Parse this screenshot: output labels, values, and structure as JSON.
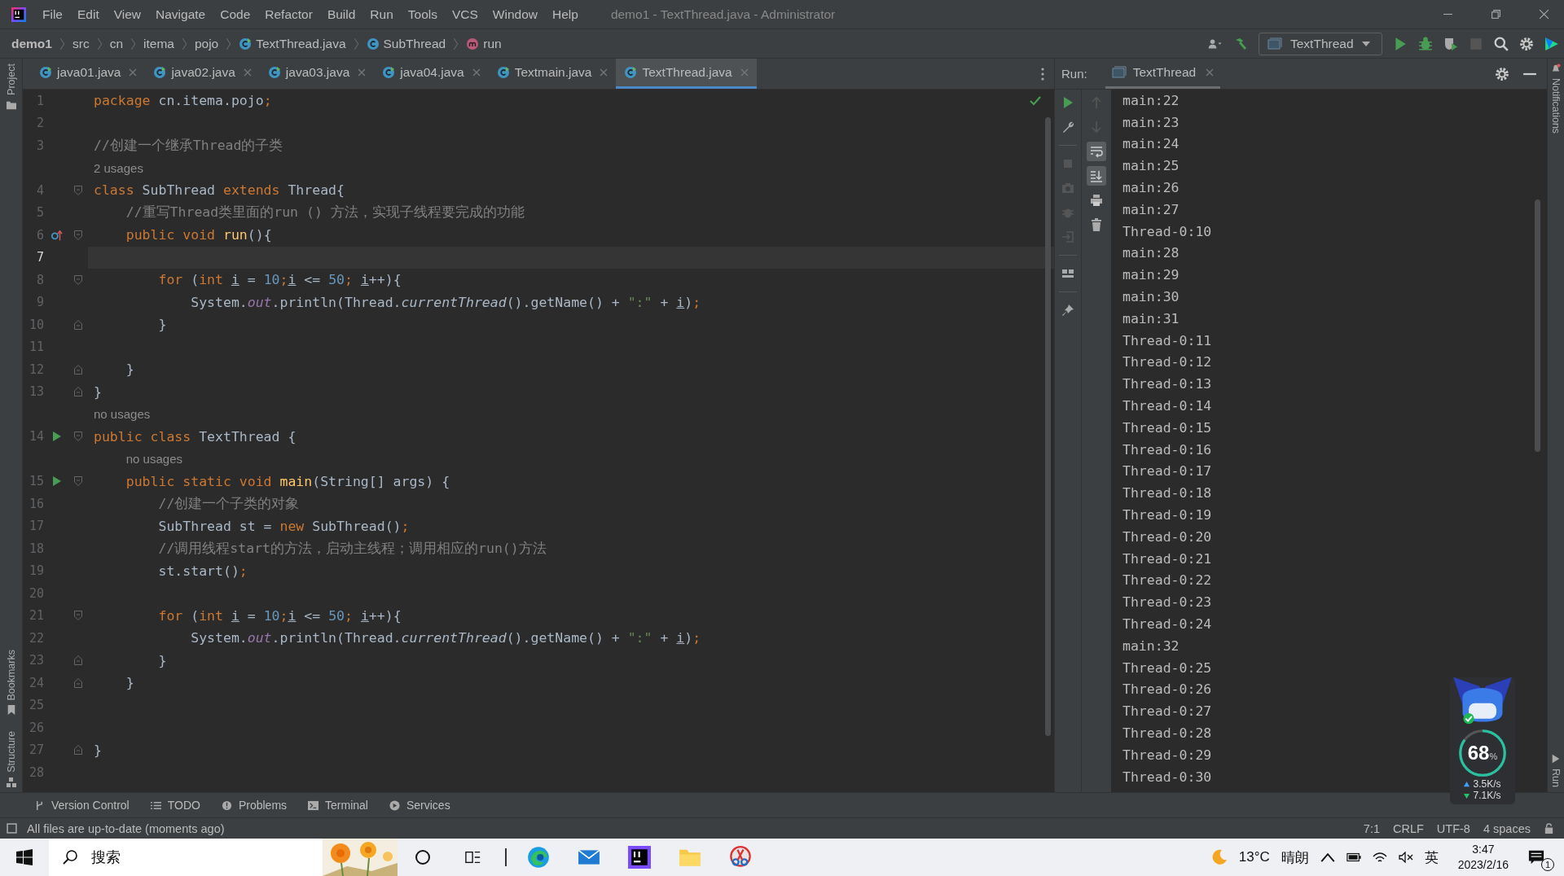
{
  "window": {
    "title": "demo1 - TextThread.java - Administrator"
  },
  "menu": [
    "File",
    "Edit",
    "View",
    "Navigate",
    "Code",
    "Refactor",
    "Build",
    "Run",
    "Tools",
    "VCS",
    "Window",
    "Help"
  ],
  "breadcrumbs": [
    {
      "label": "demo1",
      "kind": "project"
    },
    {
      "label": "src",
      "kind": "folder"
    },
    {
      "label": "cn",
      "kind": "folder"
    },
    {
      "label": "itema",
      "kind": "folder"
    },
    {
      "label": "pojo",
      "kind": "folder"
    },
    {
      "label": "TextThread.java",
      "kind": "file"
    },
    {
      "label": "SubThread",
      "kind": "class"
    },
    {
      "label": "run",
      "kind": "method"
    }
  ],
  "run_config": "TextThread",
  "side_tabs_left_top": [
    "Project"
  ],
  "side_tabs_left_bottom": [
    "Bookmarks",
    "Structure"
  ],
  "side_tabs_right_top": [
    "Notifications"
  ],
  "side_tabs_right_bottom": [
    "Run"
  ],
  "editor_tabs": [
    {
      "label": "java01.java",
      "selected": false
    },
    {
      "label": "java02.java",
      "selected": false
    },
    {
      "label": "java03.java",
      "selected": false
    },
    {
      "label": "java04.java",
      "selected": false
    },
    {
      "label": "Textmain.java",
      "selected": false
    },
    {
      "label": "TextThread.java",
      "selected": true
    }
  ],
  "editor_rows": [
    {
      "kind": "code",
      "no": "1",
      "current": false,
      "tokens": [
        {
          "t": "package",
          "kind": "kw"
        },
        {
          "t": " cn.itema.pojo",
          "kind": "p"
        },
        {
          "t": ";",
          "kind": "kw"
        }
      ]
    },
    {
      "kind": "code",
      "no": "2",
      "current": false
    },
    {
      "kind": "code",
      "no": "3",
      "current": false,
      "tokens": [
        {
          "t": "//创建一个继承Thread的子类",
          "kind": "c"
        }
      ]
    },
    {
      "kind": "hint",
      "text": "2 usages"
    },
    {
      "kind": "code",
      "no": "4",
      "current": false,
      "fold": {
        "kind": "open"
      },
      "tokens": [
        {
          "t": "class",
          "kind": "kw"
        },
        {
          "t": " SubThread ",
          "kind": "p"
        },
        {
          "t": "extends",
          "kind": "kw"
        },
        {
          "t": " Thread{",
          "kind": "p"
        }
      ]
    },
    {
      "kind": "code",
      "no": "5",
      "current": false,
      "tokens": [
        {
          "t": "    //重写Thread类里面的run () 方法，实现子线程要完成的功能",
          "kind": "c"
        }
      ]
    },
    {
      "kind": "code",
      "no": "6",
      "current": false,
      "marker": {
        "kind": "override"
      },
      "fold": {
        "kind": "open"
      },
      "tokens": [
        {
          "t": "    public void ",
          "kind": "kw"
        },
        {
          "t": "run",
          "kind": "d"
        },
        {
          "t": "(){",
          "kind": "p"
        }
      ]
    },
    {
      "kind": "code",
      "no": "7",
      "current": true
    },
    {
      "kind": "code",
      "no": "8",
      "current": false,
      "fold": {
        "kind": "open"
      },
      "tokens": [
        {
          "t": "        for",
          "kind": "kw"
        },
        {
          "t": " (",
          "kind": "p"
        },
        {
          "t": "int ",
          "kind": "kw"
        },
        {
          "t": "i",
          "kind": "u"
        },
        {
          "t": " = ",
          "kind": "p"
        },
        {
          "t": "10",
          "kind": "n"
        },
        {
          "t": ";",
          "kind": "kw"
        },
        {
          "t": "i",
          "kind": "u"
        },
        {
          "t": " <= ",
          "kind": "p"
        },
        {
          "t": "50",
          "kind": "n"
        },
        {
          "t": "; ",
          "kind": "kw"
        },
        {
          "t": "i",
          "kind": "u"
        },
        {
          "t": "++){",
          "kind": "p"
        }
      ]
    },
    {
      "kind": "code",
      "no": "9",
      "current": false,
      "tokens": [
        {
          "t": "            System.",
          "kind": "p"
        },
        {
          "t": "out",
          "kind": "f"
        },
        {
          "t": ".println(Thread.",
          "kind": "p"
        },
        {
          "t": "currentThread",
          "kind": "i"
        },
        {
          "t": "().getName() + ",
          "kind": "p"
        },
        {
          "t": "\":\"",
          "kind": "s"
        },
        {
          "t": " + ",
          "kind": "p"
        },
        {
          "t": "i",
          "kind": "u"
        },
        {
          "t": ")",
          "kind": "p"
        },
        {
          "t": ";",
          "kind": "kw"
        }
      ]
    },
    {
      "kind": "code",
      "no": "10",
      "current": false,
      "fold": {
        "kind": "close"
      },
      "tokens": [
        {
          "t": "        }",
          "kind": "p"
        }
      ]
    },
    {
      "kind": "code",
      "no": "11",
      "current": false
    },
    {
      "kind": "code",
      "no": "12",
      "current": false,
      "fold": {
        "kind": "close"
      },
      "tokens": [
        {
          "t": "    }",
          "kind": "p"
        }
      ]
    },
    {
      "kind": "code",
      "no": "13",
      "current": false,
      "fold": {
        "kind": "close"
      },
      "tokens": [
        {
          "t": "}",
          "kind": "p"
        }
      ]
    },
    {
      "kind": "hint",
      "text": "no usages"
    },
    {
      "kind": "code",
      "no": "14",
      "current": false,
      "marker": {
        "kind": "run"
      },
      "fold": {
        "kind": "open"
      },
      "tokens": [
        {
          "t": "public class",
          "kind": "kw"
        },
        {
          "t": " TextThread {",
          "kind": "p"
        }
      ]
    },
    {
      "kind": "hint",
      "text": "    no usages"
    },
    {
      "kind": "code",
      "no": "15",
      "current": false,
      "marker": {
        "kind": "run"
      },
      "fold": {
        "kind": "open"
      },
      "tokens": [
        {
          "t": "    public static void ",
          "kind": "kw"
        },
        {
          "t": "main",
          "kind": "d"
        },
        {
          "t": "(String[] args) {",
          "kind": "p"
        }
      ]
    },
    {
      "kind": "code",
      "no": "16",
      "current": false,
      "tokens": [
        {
          "t": "        //创建一个子类的对象",
          "kind": "c"
        }
      ]
    },
    {
      "kind": "code",
      "no": "17",
      "current": false,
      "tokens": [
        {
          "t": "        SubThread st = ",
          "kind": "p"
        },
        {
          "t": "new",
          "kind": "kw"
        },
        {
          "t": " SubThread()",
          "kind": "p"
        },
        {
          "t": ";",
          "kind": "kw"
        }
      ]
    },
    {
      "kind": "code",
      "no": "18",
      "current": false,
      "tokens": [
        {
          "t": "        //调用线程start的方法，启动主线程；调用相应的run()方法",
          "kind": "c"
        }
      ]
    },
    {
      "kind": "code",
      "no": "19",
      "current": false,
      "tokens": [
        {
          "t": "        st.start()",
          "kind": "p"
        },
        {
          "t": ";",
          "kind": "kw"
        }
      ]
    },
    {
      "kind": "code",
      "no": "20",
      "current": false
    },
    {
      "kind": "code",
      "no": "21",
      "current": false,
      "fold": {
        "kind": "open"
      },
      "tokens": [
        {
          "t": "        for",
          "kind": "kw"
        },
        {
          "t": " (",
          "kind": "p"
        },
        {
          "t": "int ",
          "kind": "kw"
        },
        {
          "t": "i",
          "kind": "u"
        },
        {
          "t": " = ",
          "kind": "p"
        },
        {
          "t": "10",
          "kind": "n"
        },
        {
          "t": ";",
          "kind": "kw"
        },
        {
          "t": "i",
          "kind": "u"
        },
        {
          "t": " <= ",
          "kind": "p"
        },
        {
          "t": "50",
          "kind": "n"
        },
        {
          "t": "; ",
          "kind": "kw"
        },
        {
          "t": "i",
          "kind": "u"
        },
        {
          "t": "++){",
          "kind": "p"
        }
      ]
    },
    {
      "kind": "code",
      "no": "22",
      "current": false,
      "tokens": [
        {
          "t": "            System.",
          "kind": "p"
        },
        {
          "t": "out",
          "kind": "f"
        },
        {
          "t": ".println(Thread.",
          "kind": "p"
        },
        {
          "t": "currentThread",
          "kind": "i"
        },
        {
          "t": "().getName() + ",
          "kind": "p"
        },
        {
          "t": "\":\"",
          "kind": "s"
        },
        {
          "t": " + ",
          "kind": "p"
        },
        {
          "t": "i",
          "kind": "u"
        },
        {
          "t": ")",
          "kind": "p"
        },
        {
          "t": ";",
          "kind": "kw"
        }
      ]
    },
    {
      "kind": "code",
      "no": "23",
      "current": false,
      "fold": {
        "kind": "close"
      },
      "tokens": [
        {
          "t": "        }",
          "kind": "p"
        }
      ]
    },
    {
      "kind": "code",
      "no": "24",
      "current": false,
      "fold": {
        "kind": "close"
      },
      "tokens": [
        {
          "t": "    }",
          "kind": "p"
        }
      ]
    },
    {
      "kind": "code",
      "no": "25",
      "current": false
    },
    {
      "kind": "code",
      "no": "26",
      "current": false
    },
    {
      "kind": "code",
      "no": "27",
      "current": false,
      "fold": {
        "kind": "close"
      },
      "tokens": [
        {
          "t": "}",
          "kind": "p"
        }
      ]
    },
    {
      "kind": "code",
      "no": "28",
      "current": false
    }
  ],
  "run_panel": {
    "label": "Run:",
    "tab": "TextThread",
    "console": [
      "main:22",
      "main:23",
      "main:24",
      "main:25",
      "main:26",
      "main:27",
      "Thread-0:10",
      "main:28",
      "main:29",
      "main:30",
      "main:31",
      "Thread-0:11",
      "Thread-0:12",
      "Thread-0:13",
      "Thread-0:14",
      "Thread-0:15",
      "Thread-0:16",
      "Thread-0:17",
      "Thread-0:18",
      "Thread-0:19",
      "Thread-0:20",
      "Thread-0:21",
      "Thread-0:22",
      "Thread-0:23",
      "Thread-0:24",
      "main:32",
      "Thread-0:25",
      "Thread-0:26",
      "Thread-0:27",
      "Thread-0:28",
      "Thread-0:29",
      "Thread-0:30"
    ]
  },
  "tool_tabs": [
    {
      "label": "Version Control",
      "kind": "vcs"
    },
    {
      "label": "TODO",
      "kind": "todo"
    },
    {
      "label": "Problems",
      "kind": "problems"
    },
    {
      "label": "Terminal",
      "kind": "terminal"
    },
    {
      "label": "Services",
      "kind": "services"
    }
  ],
  "status_bar": {
    "message": "All files are up-to-date (moments ago)",
    "items": [
      "7:1",
      "CRLF",
      "UTF-8",
      "4 spaces"
    ]
  },
  "monitor": {
    "percent": "68",
    "unit": "%",
    "upload": "3.5K/s",
    "download": "7.1K/s"
  },
  "taskbar": {
    "search": {
      "placeholder": "搜索"
    },
    "apps": [
      {
        "kind": "cortana"
      },
      {
        "kind": "taskview"
      },
      {
        "kind": "edge"
      },
      {
        "kind": "mail"
      },
      {
        "kind": "intellij"
      },
      {
        "kind": "folder"
      },
      {
        "kind": "tool"
      }
    ],
    "weather": {
      "temp": "13°C",
      "condition": "晴朗"
    },
    "ime": "英",
    "time": "3:47",
    "date": "2023/2/16",
    "notifications": "1"
  }
}
